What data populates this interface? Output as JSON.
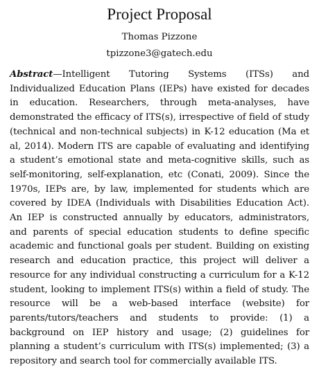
{
  "paper": {
    "title": "Project Proposal",
    "author": "Thomas Pizzone",
    "email": "tpizzone3@gatech.edu",
    "abstract_label": "Abstract",
    "abstract_dash": "—",
    "abstract_text": "Intelligent Tutoring Systems (ITSs) and Individualized Education Plans (IEPs) have existed for decades in education. Researchers, through meta-analyses, have demonstrated the efficacy of ITS(s), irrespective of field of study (technical and non-technical subjects) in K-12 education (Ma et al, 2014). Modern ITS are capable of evaluating and identifying a student’s emotional state and meta-cognitive skills, such as self-monitoring, self-explanation, etc (Conati, 2009). Since the 1970s, IEPs are, by law, implemented for students which are covered by IDEA (Individuals with Disabilities Education Act). An IEP is constructed annually by educators, administrators, and parents of special education students to define specific academic and functional goals per student. Building on existing research and education practice, this project will deliver a resource for any individual constructing a curriculum for a K-12 student, looking to implement ITS(s) within a field of study. The resource will be a web-based interface (website) for parents/tutors/teachers and students to provide: (1) a background on IEP history and usage; (2) guidelines for planning a student’s curriculum with ITS(s) implemented; (3) a repository and search tool for commercially available ITS."
  }
}
